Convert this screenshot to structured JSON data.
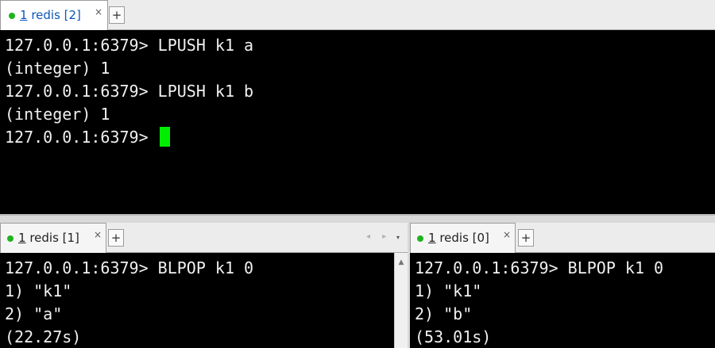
{
  "top_pane": {
    "tab": {
      "number": "1",
      "label": " redis [2]",
      "close": "×"
    },
    "new_tab": "+",
    "lines": [
      "127.0.0.1:6379> LPUSH k1 a",
      "(integer) 1",
      "127.0.0.1:6379> LPUSH k1 b",
      "(integer) 1",
      "127.0.0.1:6379> "
    ]
  },
  "bottom_left_pane": {
    "tab": {
      "number": "1",
      "label": " redis [1]",
      "close": "×"
    },
    "new_tab": "+",
    "nav_arrows": "◂ ▸",
    "dropdown": "▾",
    "lines": [
      "127.0.0.1:6379> BLPOP k1 0",
      "1) \"k1\"",
      "2) \"a\"",
      "(22.27s)"
    ],
    "scroll_up": "▲"
  },
  "bottom_right_pane": {
    "tab": {
      "number": "1",
      "label": " redis [0]",
      "close": "×"
    },
    "new_tab": "+",
    "lines": [
      "127.0.0.1:6379> BLPOP k1 0",
      "1) \"k1\"",
      "2) \"b\"",
      "(53.01s)"
    ]
  },
  "colors": {
    "terminal_bg": "#000000",
    "terminal_fg": "#f0f0f0",
    "cursor": "#00ee00",
    "active_tab_text": "#0b57b8",
    "status_dot": "#1fb31f"
  }
}
